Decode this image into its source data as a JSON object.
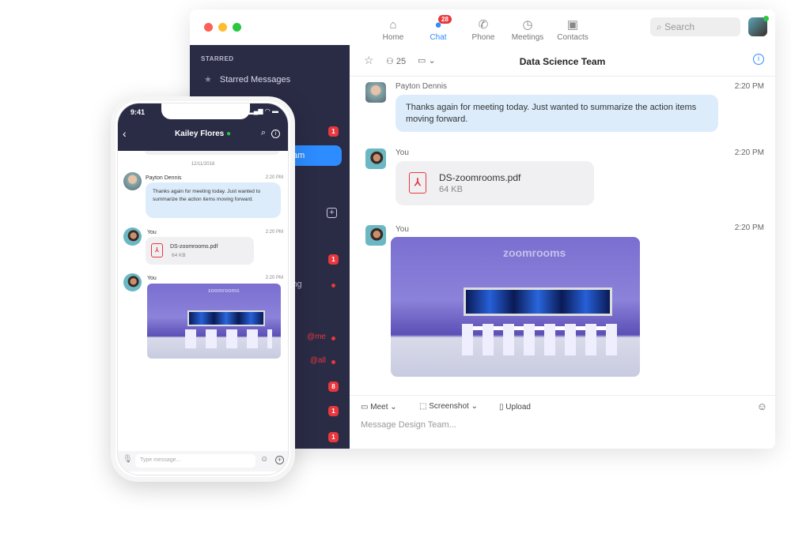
{
  "desktop": {
    "nav": [
      {
        "label": "Home",
        "icon": "home-icon"
      },
      {
        "label": "Chat",
        "icon": "chat-icon",
        "badge": "28",
        "active": true
      },
      {
        "label": "Phone",
        "icon": "phone-icon"
      },
      {
        "label": "Meetings",
        "icon": "clock-icon"
      },
      {
        "label": "Contacts",
        "icon": "contacts-icon"
      }
    ],
    "search_placeholder": "Search",
    "sidebar": {
      "section": "STARRED",
      "starred_label": "Starred Messages",
      "active_fragment": "am",
      "item_fragment": "ing",
      "badges": [
        "1",
        "1",
        "8",
        "1",
        "1"
      ],
      "mention_me": "@me",
      "mention_all": "@all"
    },
    "chat": {
      "title": "Data Science Team",
      "members": "25",
      "messages": [
        {
          "sender": "Payton Dennis",
          "time": "2:20 PM",
          "text": "Thanks again for meeting today. Just wanted to summarize the action items moving forward."
        },
        {
          "sender": "You",
          "time": "2:20 PM",
          "file_name": "DS-zoomrooms.pdf",
          "file_size": "64 KB"
        },
        {
          "sender": "You",
          "time": "2:20 PM",
          "image_logo": "zoomrooms"
        }
      ],
      "toolbar": {
        "meet": "Meet",
        "screenshot": "Screenshot",
        "upload": "Upload"
      },
      "input_placeholder": "Message Design Team..."
    }
  },
  "phone": {
    "clock": "9:41",
    "contact": "Kailey Flores",
    "date": "12/11/2018",
    "messages": [
      {
        "sender": "Payton Dennis",
        "time": "2:20 PM",
        "text": "Thanks again for meeting today. Just wanted to summarize the action items moving forward."
      },
      {
        "sender": "You",
        "time": "2:20 PM",
        "file_name": "DS-zoomrooms.pdf",
        "file_size": "64 KB"
      },
      {
        "sender": "You",
        "time": "2:20 PM"
      }
    ],
    "input_placeholder": "Type message..."
  },
  "colors": {
    "accent": "#2d8cff",
    "sidebar": "#2a2b45",
    "badge": "#e8383d",
    "bubble": "#dcecfb"
  }
}
